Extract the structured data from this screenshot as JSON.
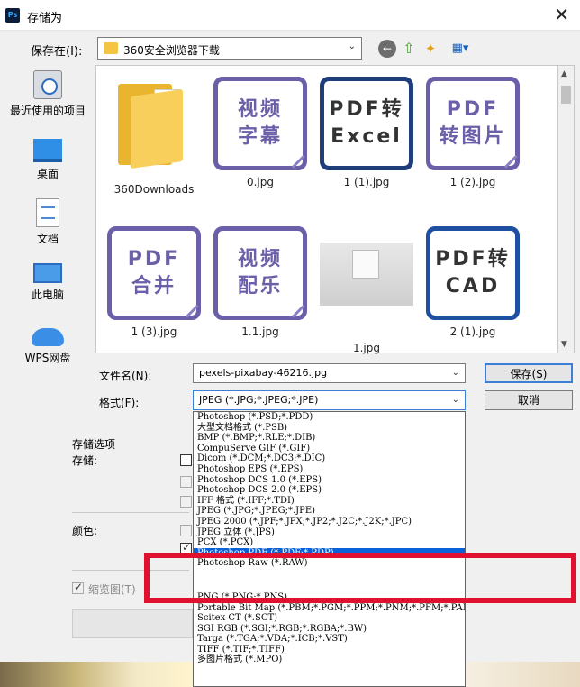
{
  "window": {
    "title": "存储为",
    "app_icon": "Ps"
  },
  "toolbar": {
    "save_in_label": "保存在(I):",
    "location": "360安全浏览器下载",
    "back_icon": "back-arrow-icon",
    "up_icon": "up-folder-icon",
    "new_folder_icon": "new-folder-icon",
    "view_icon": "view-menu-icon"
  },
  "places": [
    {
      "label": "最近使用的项目",
      "icon": "recent-items-icon"
    },
    {
      "label": "桌面",
      "icon": "desktop-icon"
    },
    {
      "label": "文档",
      "icon": "documents-icon"
    },
    {
      "label": "此电脑",
      "icon": "computer-icon"
    },
    {
      "label": "WPS网盘",
      "icon": "cloud-icon"
    }
  ],
  "files": [
    {
      "caption": "360Downloads",
      "kind": "folder"
    },
    {
      "caption": "0.jpg",
      "kind": "card",
      "line1": "视频",
      "line2": "字幕"
    },
    {
      "caption": "1 (1).jpg",
      "kind": "dark-card",
      "line1": "PDF转",
      "line2": "Excel"
    },
    {
      "caption": "1 (2).jpg",
      "kind": "card",
      "line1": "PDF",
      "line2": "转图片"
    },
    {
      "caption": "1 (3).jpg",
      "kind": "card",
      "line1": "PDF",
      "line2": "合并"
    },
    {
      "caption": "1.1.jpg",
      "kind": "card",
      "line1": "视频",
      "line2": "配乐"
    },
    {
      "caption": "1.jpg",
      "kind": "photo"
    },
    {
      "caption": "2 (1).jpg",
      "kind": "dark-card",
      "line1": "PDF转",
      "line2": "CAD"
    }
  ],
  "form": {
    "filename_label": "文件名(N):",
    "filename_value": "pexels-pixabay-46216.jpg",
    "format_label": "格式(F):",
    "format_value": "JPEG (*.JPG;*.JPEG;*.JPE)",
    "save_button": "保存(S)",
    "cancel_button": "取消"
  },
  "options": {
    "group_title": "存储选项",
    "save_label": "存储:",
    "color_label": "颜色:",
    "thumbnail_label": "缩览图(T)"
  },
  "format_options": [
    "Photoshop (*.PSD;*.PDD)",
    "大型文档格式 (*.PSB)",
    "BMP (*.BMP;*.RLE;*.DIB)",
    "CompuServe GIF (*.GIF)",
    "Dicom (*.DCM;*.DC3;*.DIC)",
    "Photoshop EPS (*.EPS)",
    "Photoshop DCS 1.0 (*.EPS)",
    "Photoshop DCS 2.0 (*.EPS)",
    "IFF 格式 (*.IFF;*.TDI)",
    "JPEG (*.JPG;*.JPEG;*.JPE)",
    "JPEG 2000 (*.JPF;*.JPX;*.JP2;*.J2C;*.J2K;*.JPC)",
    "JPEG 立体 (*.JPS)",
    "PCX (*.PCX)",
    "Photoshop PDF (*.PDF;*.PDP)",
    "Photoshop Raw (*.RAW)",
    "PNG (*.PNG;*.PNS)",
    "Portable Bit Map (*.PBM;*.PGM;*.PPM;*.PNM;*.PFM;*.PAM)",
    "Scitex CT (*.SCT)",
    "SGI RGB (*.SGI;*.RGB;*.RGBA;*.BW)",
    "Targa (*.TGA;*.VDA;*.ICB;*.VST)",
    "TIFF (*.TIF;*.TIFF)",
    "多图片格式 (*.MPO)"
  ],
  "selected_format": "Photoshop PDF (*.PDF;*.PDP)",
  "colors": {
    "highlight": "#e0102e",
    "selection": "#0a62d8",
    "card": "#6a5fa8"
  }
}
